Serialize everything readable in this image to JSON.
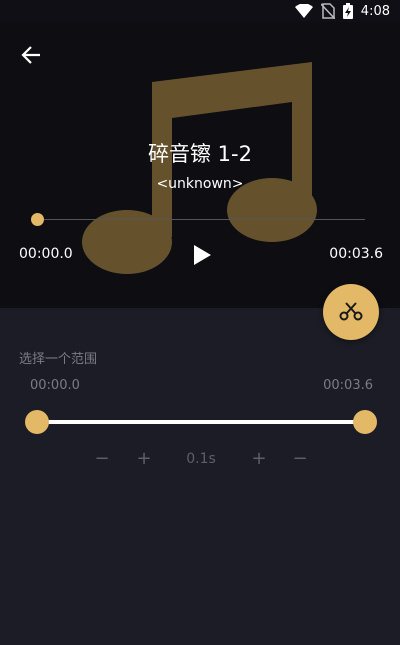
{
  "status_bar": {
    "time": "4:08",
    "icons": [
      "wifi-icon",
      "no-sim-icon",
      "battery-charging-icon"
    ]
  },
  "player": {
    "title": "碎音镲 1-2",
    "artist": "<unknown>",
    "current_time": "00:00.0",
    "total_time": "00:03.6",
    "progress": 0.0,
    "icons": [
      "back-arrow-icon",
      "play-icon",
      "music-note-icon"
    ]
  },
  "cut_button": {
    "icon": "scissors-icon"
  },
  "range": {
    "label": "选择一个范围",
    "start_time": "00:00.0",
    "end_time": "00:03.6",
    "start_fraction": 0.0,
    "end_fraction": 1.0,
    "step_label": "0.1s",
    "controls": [
      "−",
      "+",
      "+",
      "−"
    ]
  },
  "colors": {
    "accent": "#e3b867",
    "background": "#1c1c26",
    "player_background": "#0d0d12",
    "muted_text": "#7b7b86"
  }
}
